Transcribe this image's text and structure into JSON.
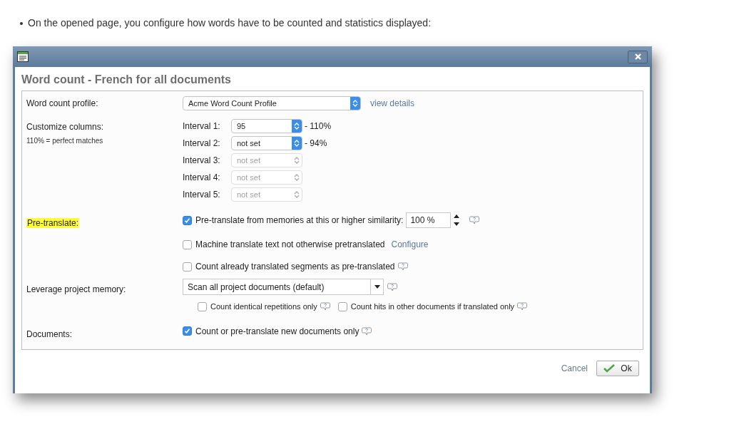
{
  "intro": "On the opened page, you configure how words have to be counted and statistics displayed:",
  "dialog": {
    "heading": "Word count - French for all documents",
    "profile": {
      "label": "Word count profile:",
      "value": "Acme Word Count Profile",
      "link": "view details"
    },
    "columns": {
      "label": "Customize columns:",
      "note": "110% = perfect matches",
      "intervals": [
        {
          "label": "Interval 1:",
          "value": "95",
          "suffix": "- 110%",
          "disabled": false
        },
        {
          "label": "Interval 2:",
          "value": "not set",
          "suffix": "- 94%",
          "disabled": false
        },
        {
          "label": "Interval 3:",
          "value": "not set",
          "disabled": true
        },
        {
          "label": "Interval 4:",
          "value": "not set",
          "disabled": true
        },
        {
          "label": "Interval 5:",
          "value": "not set",
          "disabled": true
        }
      ]
    },
    "pretranslate": {
      "label": "Pre-translate:",
      "highlighted": true,
      "options": [
        {
          "label": "Pre-translate from memories at this or higher similarity:",
          "checked": true,
          "similarity": "100 %",
          "help": true
        },
        {
          "label": "Machine translate text not otherwise pretranslated",
          "checked": false,
          "link": "Configure",
          "help": false
        },
        {
          "label": "Count already translated segments as pre-translated",
          "checked": false,
          "help": true
        }
      ]
    },
    "leverage": {
      "label": "Leverage project memory:",
      "value": "Scan all project documents (default)",
      "help": true,
      "options": [
        {
          "label": "Count identical repetitions only",
          "checked": false,
          "help": true
        },
        {
          "label": "Count hits in other documents if translated only",
          "checked": false,
          "help": true
        }
      ]
    },
    "documents": {
      "label": "Documents:",
      "options": [
        {
          "label": "Count or pre-translate new documents only",
          "checked": true,
          "help": true
        }
      ]
    },
    "buttons": {
      "cancel": "Cancel",
      "ok": "Ok"
    }
  }
}
